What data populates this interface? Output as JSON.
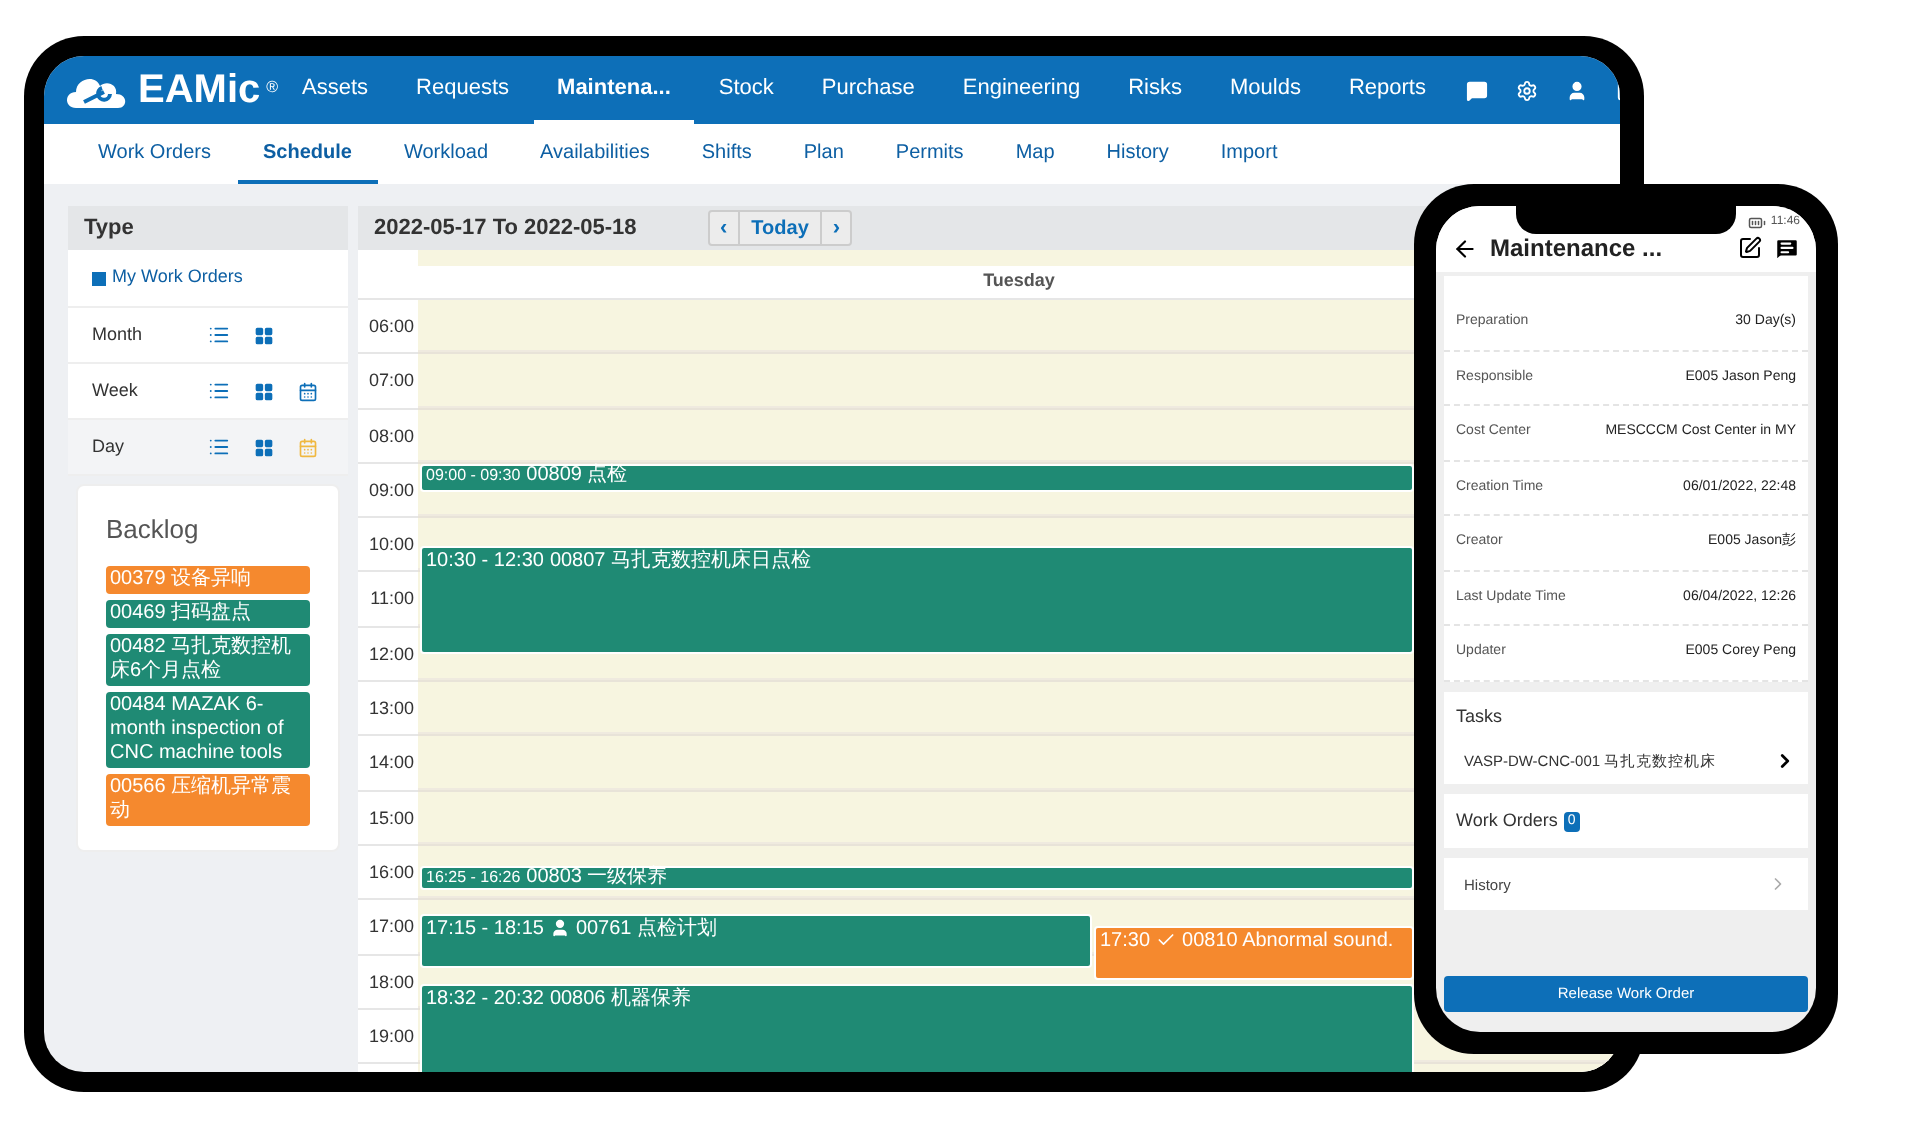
{
  "tablet": {
    "logo_text": "EAMic",
    "logo_mark": "®",
    "nav": [
      {
        "label": "Assets",
        "selected": false
      },
      {
        "label": "Requests",
        "selected": false
      },
      {
        "label": "Maintena...",
        "selected": true
      },
      {
        "label": "Stock",
        "selected": false
      },
      {
        "label": "Purchase",
        "selected": false
      },
      {
        "label": "Engineering",
        "selected": false
      },
      {
        "label": "Risks",
        "selected": false
      },
      {
        "label": "Moulds",
        "selected": false
      },
      {
        "label": "Reports",
        "selected": false
      }
    ],
    "subnav": [
      {
        "label": "Work Orders",
        "selected": false
      },
      {
        "label": "Schedule",
        "selected": true
      },
      {
        "label": "Workload",
        "selected": false
      },
      {
        "label": "Availabilities",
        "selected": false
      },
      {
        "label": "Shifts",
        "selected": false
      },
      {
        "label": "Plan",
        "selected": false
      },
      {
        "label": "Permits",
        "selected": false
      },
      {
        "label": "Map",
        "selected": false
      },
      {
        "label": "History",
        "selected": false
      },
      {
        "label": "Import",
        "selected": false
      }
    ],
    "type_panel": {
      "title": "Type",
      "my_work_orders": {
        "label": "My Work Orders",
        "checked": true
      },
      "views": [
        {
          "label": "Month",
          "calendar": false,
          "selected": false
        },
        {
          "label": "Week",
          "calendar": true,
          "selected": false
        },
        {
          "label": "Day",
          "calendar": true,
          "selected": true
        }
      ]
    },
    "backlog": {
      "title": "Backlog",
      "items": [
        {
          "text": "00379 设备异响",
          "color": "#f5892e"
        },
        {
          "text": "00469 扫码盘点",
          "color": "#1f8a74"
        },
        {
          "text": "00482 马扎克数控机床6个月点检",
          "color": "#1f8a74"
        },
        {
          "text": "00484 MAZAK 6-month inspection of CNC machine tools",
          "color": "#1f8a74"
        },
        {
          "text": "00566 压缩机异常震动",
          "color": "#f5892e"
        }
      ]
    },
    "calendar": {
      "range": "2022-05-17 To 2022-05-18",
      "today": "Today",
      "prev": "‹",
      "next": "›",
      "day": "Tuesday",
      "hours": [
        "06:00",
        "07:00",
        "08:00",
        "09:00",
        "10:00",
        "11:00",
        "12:00",
        "13:00",
        "14:00",
        "15:00",
        "16:00",
        "17:00",
        "18:00",
        "19:00"
      ],
      "events": [
        {
          "time": "09:00 - 09:30",
          "title": "00809 点检",
          "kind": "plain",
          "color": "#1f8a74"
        },
        {
          "time": "10:30 - 12:30",
          "title": "00807 马扎克数控机床日点检",
          "kind": "plain",
          "color": "#1f8a74"
        },
        {
          "time": "16:25 - 16:26",
          "title": "00803 一级保养",
          "kind": "plain",
          "color": "#1f8a74"
        },
        {
          "time": "17:15 - 18:15",
          "title": "00761 点检计划",
          "kind": "assigned",
          "color": "#1f8a74"
        },
        {
          "time": "17:30",
          "title": "00810 Abnormal sound.",
          "kind": "done",
          "color": "#f5892e"
        },
        {
          "time": "18:32 - 20:32",
          "title": "00806 机器保养",
          "kind": "plain",
          "color": "#1f8a74"
        }
      ]
    }
  },
  "phone": {
    "status_time": "11:46",
    "title": "Maintenance ...",
    "details": [
      {
        "label": "Preparation",
        "value": "30 Day(s)"
      },
      {
        "label": "Responsible",
        "value": "E005 Jason Peng"
      },
      {
        "label": "Cost Center",
        "value": "MESCCCM Cost Center in MY"
      },
      {
        "label": "Creation Time",
        "value": "06/01/2022, 22:48"
      },
      {
        "label": "Creator",
        "value": "E005 Jason彭"
      },
      {
        "label": "Last Update Time",
        "value": "06/04/2022, 12:26"
      },
      {
        "label": "Updater",
        "value": "E005 Corey Peng"
      }
    ],
    "tasks": {
      "title": "Tasks",
      "item": "VASP-DW-CNC-001 马扎克数控机床"
    },
    "work_orders": {
      "title": "Work Orders",
      "count": "0"
    },
    "history": "History",
    "release_button": "Release Work Order"
  }
}
